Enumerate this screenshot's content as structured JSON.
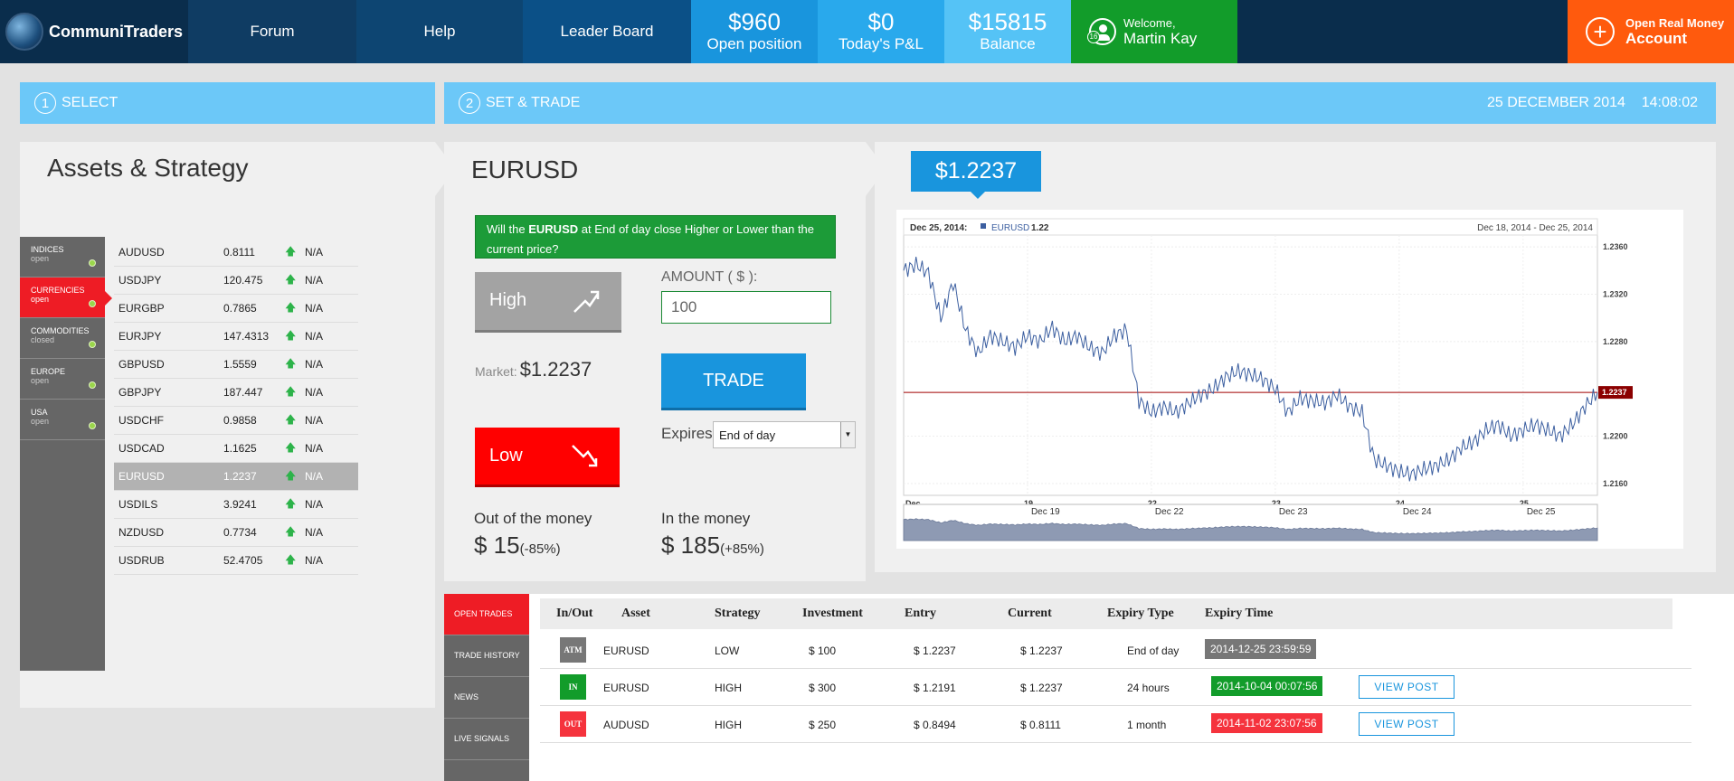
{
  "header": {
    "brand": "CommuniTraders",
    "nav": [
      "Forum",
      "Help",
      "Leader Board"
    ],
    "stats": [
      {
        "value": "$960",
        "label": "Open position"
      },
      {
        "value": "$0",
        "label": "Today's P&L"
      },
      {
        "value": "$15815",
        "label": "Balance"
      }
    ],
    "welcome_line": "Welcome,",
    "user_name": "Martin Kay",
    "user_level": "16",
    "open_account_line1": "Open Real Money",
    "open_account_line2": "Account"
  },
  "steps": {
    "step1_num": "1",
    "step1_label": "SELECT",
    "step2_num": "2",
    "step2_label": "SET & TRADE",
    "date": "25 DECEMBER 2014",
    "time": "14:08:02"
  },
  "assets_panel": {
    "title": "Assets & Strategy",
    "categories": [
      {
        "name": "INDICES",
        "status": "open"
      },
      {
        "name": "CURRENCIES",
        "status": "open"
      },
      {
        "name": "COMMODITIES",
        "status": "closed"
      },
      {
        "name": "EUROPE",
        "status": "open"
      },
      {
        "name": "USA",
        "status": "open"
      }
    ],
    "assets": [
      {
        "name": "AUDUSD",
        "price": "0.8111",
        "change": "N/A"
      },
      {
        "name": "USDJPY",
        "price": "120.475",
        "change": "N/A"
      },
      {
        "name": "EURGBP",
        "price": "0.7865",
        "change": "N/A"
      },
      {
        "name": "EURJPY",
        "price": "147.4313",
        "change": "N/A"
      },
      {
        "name": "GBPUSD",
        "price": "1.5559",
        "change": "N/A"
      },
      {
        "name": "GBPJPY",
        "price": "187.447",
        "change": "N/A"
      },
      {
        "name": "USDCHF",
        "price": "0.9858",
        "change": "N/A"
      },
      {
        "name": "USDCAD",
        "price": "1.1625",
        "change": "N/A"
      },
      {
        "name": "EURUSD",
        "price": "1.2237",
        "change": "N/A"
      },
      {
        "name": "USDILS",
        "price": "3.9241",
        "change": "N/A"
      },
      {
        "name": "NZDUSD",
        "price": "0.7734",
        "change": "N/A"
      },
      {
        "name": "USDRUB",
        "price": "52.4705",
        "change": "N/A"
      }
    ]
  },
  "trade_panel": {
    "asset": "EURUSD",
    "question_pre": "Will the ",
    "question_asset": "EURUSD",
    "question_post": " at End of day close Higher or Lower than the current price?",
    "high_label": "High",
    "low_label": "Low",
    "amount_label": "AMOUNT ( $ ):",
    "amount_value": "100",
    "market_label": "Market:",
    "market_value": "$1.2237",
    "trade_label": "TRADE",
    "expires_label": "Expires",
    "expires_value": "End of day",
    "otm_label": "Out of the money",
    "otm_value": "$ 15",
    "otm_pct": "(-85%)",
    "itm_label": "In the money",
    "itm_value": "$ 185",
    "itm_pct": "(+85%)"
  },
  "chart": {
    "price_bubble": "$1.2237",
    "header_date": "Dec 25, 2014:",
    "series_name": "EURUSD",
    "series_value": "1.22",
    "range": "Dec 18, 2014 - Dec 25, 2014",
    "current_label": "1.2237",
    "x_ticks": [
      "Dec",
      "19",
      "22",
      "23",
      "24",
      "25"
    ],
    "y_ticks": [
      "1.2360",
      "1.2320",
      "1.2280",
      "1.2200",
      "1.2160"
    ],
    "nav_ticks": [
      "Dec 19",
      "Dec 22",
      "Dec 23",
      "Dec 24",
      "Dec 25"
    ],
    "accent": "#e06060"
  },
  "chart_data": {
    "type": "line",
    "series": [
      {
        "name": "EURUSD",
        "values": [
          1.234,
          1.2345,
          1.2338,
          1.23,
          1.233,
          1.229,
          1.227,
          1.2285,
          1.228,
          1.2275,
          1.2285,
          1.228,
          1.2292,
          1.228,
          1.2285,
          1.2275,
          1.227,
          1.2285,
          1.229,
          1.223,
          1.222,
          1.2225,
          1.222,
          1.2228,
          1.2235,
          1.224,
          1.225,
          1.2255,
          1.2252,
          1.2248,
          1.224,
          1.222,
          1.2232,
          1.223,
          1.2228,
          1.2235,
          1.2225,
          1.222,
          1.218,
          1.2175,
          1.217,
          1.2168,
          1.2172,
          1.2175,
          1.218,
          1.219,
          1.2195,
          1.2205,
          1.221,
          1.22,
          1.2205,
          1.221,
          1.2205,
          1.22,
          1.221,
          1.2225,
          1.2237
        ]
      }
    ],
    "x_start": "Dec 18",
    "x_end": "Dec 25",
    "ylim": [
      1.215,
      1.237
    ],
    "reference_line": 1.2237
  },
  "bottom": {
    "tabs": [
      "OPEN TRADES",
      "TRADE HISTORY",
      "NEWS",
      "LIVE SIGNALS"
    ],
    "columns": [
      "In/Out",
      "Asset",
      "Strategy",
      "Investment",
      "Entry",
      "Current",
      "Expiry Type",
      "Expiry Time"
    ],
    "rows": [
      {
        "status": "ATM",
        "status_color": "#777777",
        "asset": "EURUSD",
        "strategy": "LOW",
        "investment": "$ 100",
        "entry": "$ 1.2237",
        "current": "$ 1.2237",
        "expiry_type": "End of day",
        "expiry_time": "2014-12-25 23:59:59",
        "time_color": "#777777",
        "view": ""
      },
      {
        "status": "IN",
        "status_color": "#129c2a",
        "asset": "EURUSD",
        "strategy": "HIGH",
        "investment": "$ 300",
        "entry": "$ 1.2191",
        "current": "$ 1.2237",
        "expiry_type": "24 hours",
        "expiry_time": "2014-10-04 00:07:56",
        "time_color": "#129c2a",
        "view": "VIEW POST"
      },
      {
        "status": "OUT",
        "status_color": "#f5333d",
        "asset": "AUDUSD",
        "strategy": "HIGH",
        "investment": "$ 250",
        "entry": "$ 0.8494",
        "current": "$ 0.8111",
        "expiry_type": "1 month",
        "expiry_time": "2014-11-02 23:07:56",
        "time_color": "#f5333d",
        "view": "VIEW POST"
      }
    ]
  }
}
